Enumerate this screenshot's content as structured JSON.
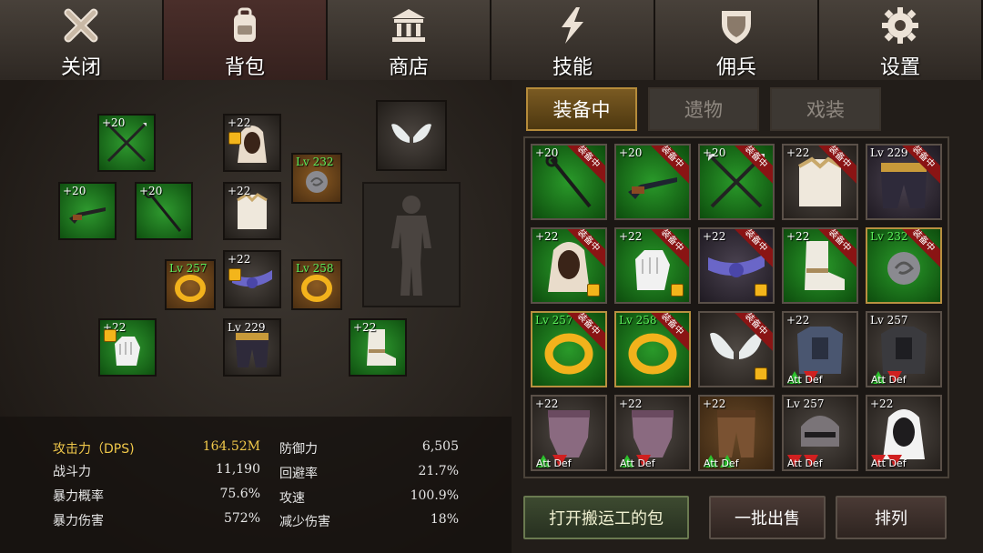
{
  "nav": [
    {
      "label": "关闭",
      "icon": "close-icon"
    },
    {
      "label": "背包",
      "icon": "backpack-icon"
    },
    {
      "label": "商店",
      "icon": "shop-icon"
    },
    {
      "label": "技能",
      "icon": "lightning-icon"
    },
    {
      "label": "佣兵",
      "icon": "shield-icon"
    },
    {
      "label": "设置",
      "icon": "gear-icon"
    }
  ],
  "equipped": [
    {
      "level": "+20",
      "item": "twin-spears-icon"
    },
    {
      "level": "+22",
      "item": "hood-icon"
    },
    {
      "level": "Lv 232",
      "item": "amulet-icon"
    },
    {
      "level": "",
      "item": "wings-icon"
    },
    {
      "level": "+20",
      "item": "musket-icon"
    },
    {
      "level": "+20",
      "item": "staff-icon"
    },
    {
      "level": "+22",
      "item": "chest-armor-icon"
    },
    {
      "level": "Lv 257",
      "item": "ring-icon"
    },
    {
      "level": "+22",
      "item": "belt-sash-icon"
    },
    {
      "level": "Lv 258",
      "item": "ring-icon"
    },
    {
      "level": "+22",
      "item": "gloves-icon"
    },
    {
      "level": "Lv 229",
      "item": "pants-icon"
    },
    {
      "level": "+22",
      "item": "boots-icon"
    }
  ],
  "stats": {
    "atk_label": "攻击力（DPS)",
    "atk_value": "164.52M",
    "def_label": "防御力",
    "def_value": "6,505",
    "power_label": "战斗力",
    "power_value": "11,190",
    "dodge_label": "回避率",
    "dodge_value": "21.7%",
    "crit_label": "暴力概率",
    "crit_value": "75.6%",
    "aspd_label": "攻速",
    "aspd_value": "100.9%",
    "critdmg_label": "暴力伤害",
    "critdmg_value": "572%",
    "reduce_label": "减少伤害",
    "reduce_value": "18%"
  },
  "tabs": [
    "装备中",
    "遗物",
    "戏装"
  ],
  "inventory": [
    {
      "level": "+20",
      "badge": "装备中",
      "item": "staff-icon",
      "cmp": ""
    },
    {
      "level": "+20",
      "badge": "装备中",
      "item": "musket-icon",
      "cmp": ""
    },
    {
      "level": "+20",
      "badge": "装备中",
      "item": "twin-spears-icon",
      "cmp": ""
    },
    {
      "level": "+22",
      "badge": "装备中",
      "item": "chest-armor-icon",
      "cmp": ""
    },
    {
      "level": "Lv 229",
      "badge": "装备中",
      "item": "pants-icon",
      "cmp": ""
    },
    {
      "level": "+22",
      "badge": "装备中",
      "item": "hood-icon",
      "cmp": ""
    },
    {
      "level": "+22",
      "badge": "装备中",
      "item": "gloves-icon",
      "cmp": ""
    },
    {
      "level": "+22",
      "badge": "装备中",
      "item": "belt-sash-icon",
      "cmp": ""
    },
    {
      "level": "+22",
      "badge": "装备中",
      "item": "boots-icon",
      "cmp": ""
    },
    {
      "level": "Lv 232",
      "badge": "装备中",
      "item": "amulet-icon",
      "cmp": ""
    },
    {
      "level": "Lv 257",
      "badge": "装备中",
      "item": "ring-icon",
      "cmp": ""
    },
    {
      "level": "Lv 258",
      "badge": "装备中",
      "item": "ring-icon",
      "cmp": ""
    },
    {
      "level": "",
      "badge": "装备中",
      "item": "wings-icon",
      "cmp": ""
    },
    {
      "level": "+22",
      "badge": "",
      "item": "plate-armor-icon",
      "cmp": "Att Def"
    },
    {
      "level": "Lv 257",
      "badge": "",
      "item": "dark-armor-icon",
      "cmp": "Att Def"
    },
    {
      "level": "+22",
      "badge": "",
      "item": "leg-armor-icon",
      "cmp": "Att Def"
    },
    {
      "level": "+22",
      "badge": "",
      "item": "leg-armor-icon",
      "cmp": "Att Def"
    },
    {
      "level": "+22",
      "badge": "",
      "item": "leather-legs-icon",
      "cmp": "Att Def"
    },
    {
      "level": "Lv 257",
      "badge": "",
      "item": "helmet-icon",
      "cmp": "Att Def"
    },
    {
      "level": "+22",
      "badge": "",
      "item": "white-hood-icon",
      "cmp": "Att Def"
    }
  ],
  "buttons": {
    "open_bag": "打开搬运工的包",
    "bulk_sell": "一批出售",
    "sort": "排列"
  }
}
